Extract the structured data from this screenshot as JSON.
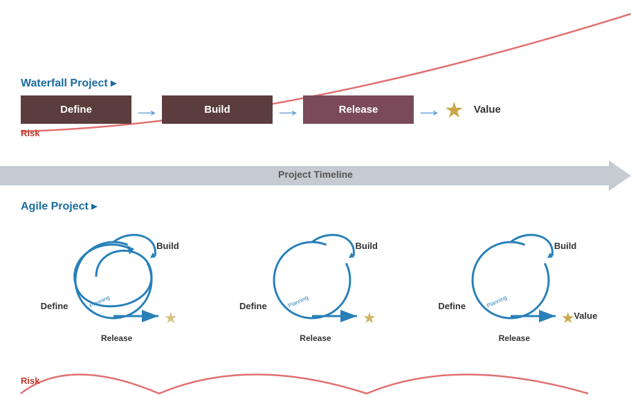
{
  "waterfall": {
    "title": "Waterfall Project ▸",
    "boxes": [
      "Define",
      "Build",
      "Release"
    ],
    "value_label": "Value",
    "risk_label": "Risk"
  },
  "timeline": {
    "label": "Project Timeline"
  },
  "agile": {
    "title": "Agile Project ▸",
    "cycles": [
      {
        "build": "Build",
        "define": "Define",
        "release": "Release"
      },
      {
        "build": "Build",
        "define": "Define",
        "release": "Release"
      },
      {
        "build": "Build",
        "define": "Define",
        "release": "Release",
        "value": "Value"
      }
    ],
    "risk_label": "Risk"
  },
  "colors": {
    "box_bg": "#5c3d3d",
    "arrow_blue": "#5b9bd5",
    "star_gold": "#c9a84c",
    "risk_red": "#c0392b",
    "title_blue": "#1a6b9e",
    "cycle_blue": "#2980b9"
  }
}
